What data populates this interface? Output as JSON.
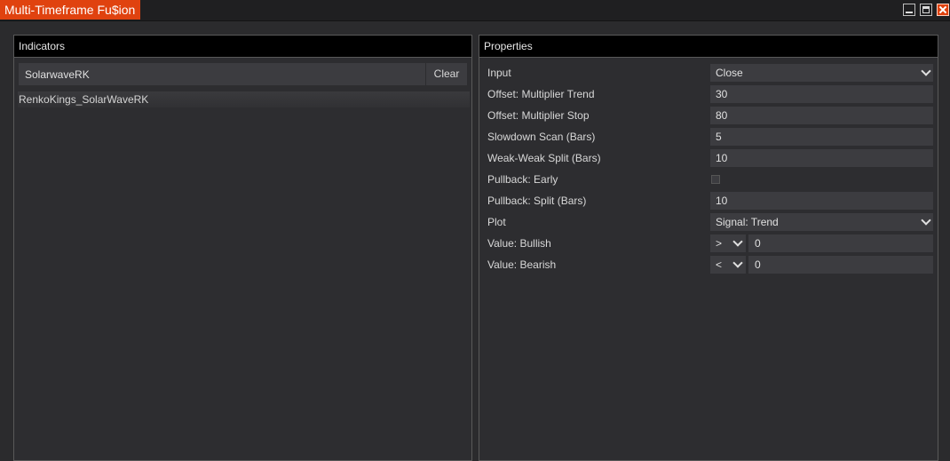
{
  "window": {
    "title": "Multi-Timeframe Fu$ion"
  },
  "indicators": {
    "header": "Indicators",
    "search_value": "SolarwaveRK",
    "clear_label": "Clear",
    "items": [
      {
        "label": "RenkoKings_SolarWaveRK"
      }
    ]
  },
  "properties": {
    "header": "Properties",
    "rows": [
      {
        "label": "Input",
        "value": "Close"
      },
      {
        "label": "Offset: Multiplier Trend",
        "value": "30"
      },
      {
        "label": "Offset: Multiplier Stop",
        "value": "80"
      },
      {
        "label": "Slowdown Scan (Bars)",
        "value": "5"
      },
      {
        "label": "Weak-Weak Split (Bars)",
        "value": "10"
      },
      {
        "label": "Pullback: Early",
        "checked": false
      },
      {
        "label": "Pullback: Split (Bars)",
        "value": "10"
      },
      {
        "label": "Plot",
        "value": "Signal: Trend"
      },
      {
        "label": "Value: Bullish",
        "operator": ">",
        "value": "0"
      },
      {
        "label": "Value: Bearish",
        "operator": "<",
        "value": "0"
      }
    ]
  },
  "colors": {
    "accent": "#e0420f",
    "background": "#2b2b2d",
    "header_bg": "#000000",
    "field_bg": "#3c3c40"
  }
}
